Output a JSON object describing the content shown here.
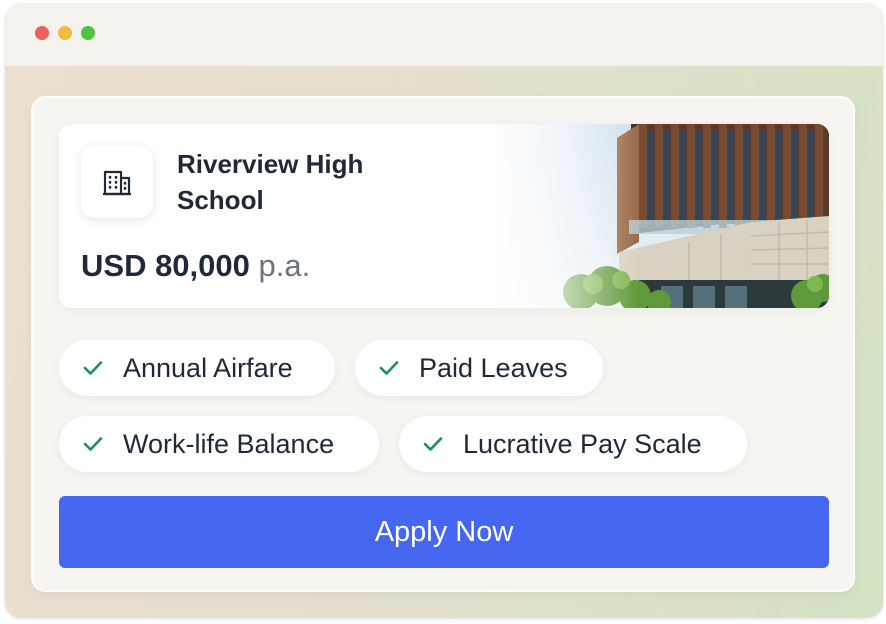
{
  "job": {
    "school": "Riverview High School",
    "salary_amount": "USD 80,000",
    "salary_unit": "p.a."
  },
  "benefits": [
    {
      "label": "Annual Airfare",
      "icon": "check-icon"
    },
    {
      "label": "Paid Leaves",
      "icon": "check-icon"
    },
    {
      "label": "Work-life Balance",
      "icon": "check-icon"
    },
    {
      "label": "Lucrative Pay Scale",
      "icon": "check-icon"
    }
  ],
  "actions": {
    "apply_label": "Apply Now"
  },
  "icons": {
    "logo": "building-icon",
    "photo": "school-building-photo"
  },
  "colors": {
    "accent": "#4566f0",
    "check": "#1f8a6a",
    "text": "#1f2937",
    "muted": "#6b7280"
  }
}
